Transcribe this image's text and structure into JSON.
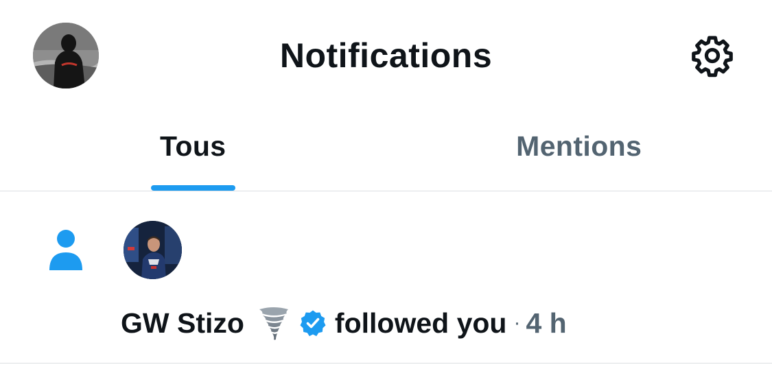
{
  "header": {
    "title": "Notifications",
    "profile_avatar_icon": "profile-avatar",
    "settings_icon": "gear-icon"
  },
  "tabs": [
    {
      "label": "Tous",
      "active": true
    },
    {
      "label": "Mentions",
      "active": false
    }
  ],
  "notifications": [
    {
      "type_icon": "person-icon",
      "user_name": "GW Stizo",
      "name_emoji": "tornado-emoji",
      "verified": true,
      "action": "followed you",
      "separator": "·",
      "time": "4 h"
    }
  ],
  "colors": {
    "accent": "#1d9bf0",
    "text_primary": "#0f1419",
    "text_secondary": "#536471",
    "divider": "#dcdfe2"
  }
}
